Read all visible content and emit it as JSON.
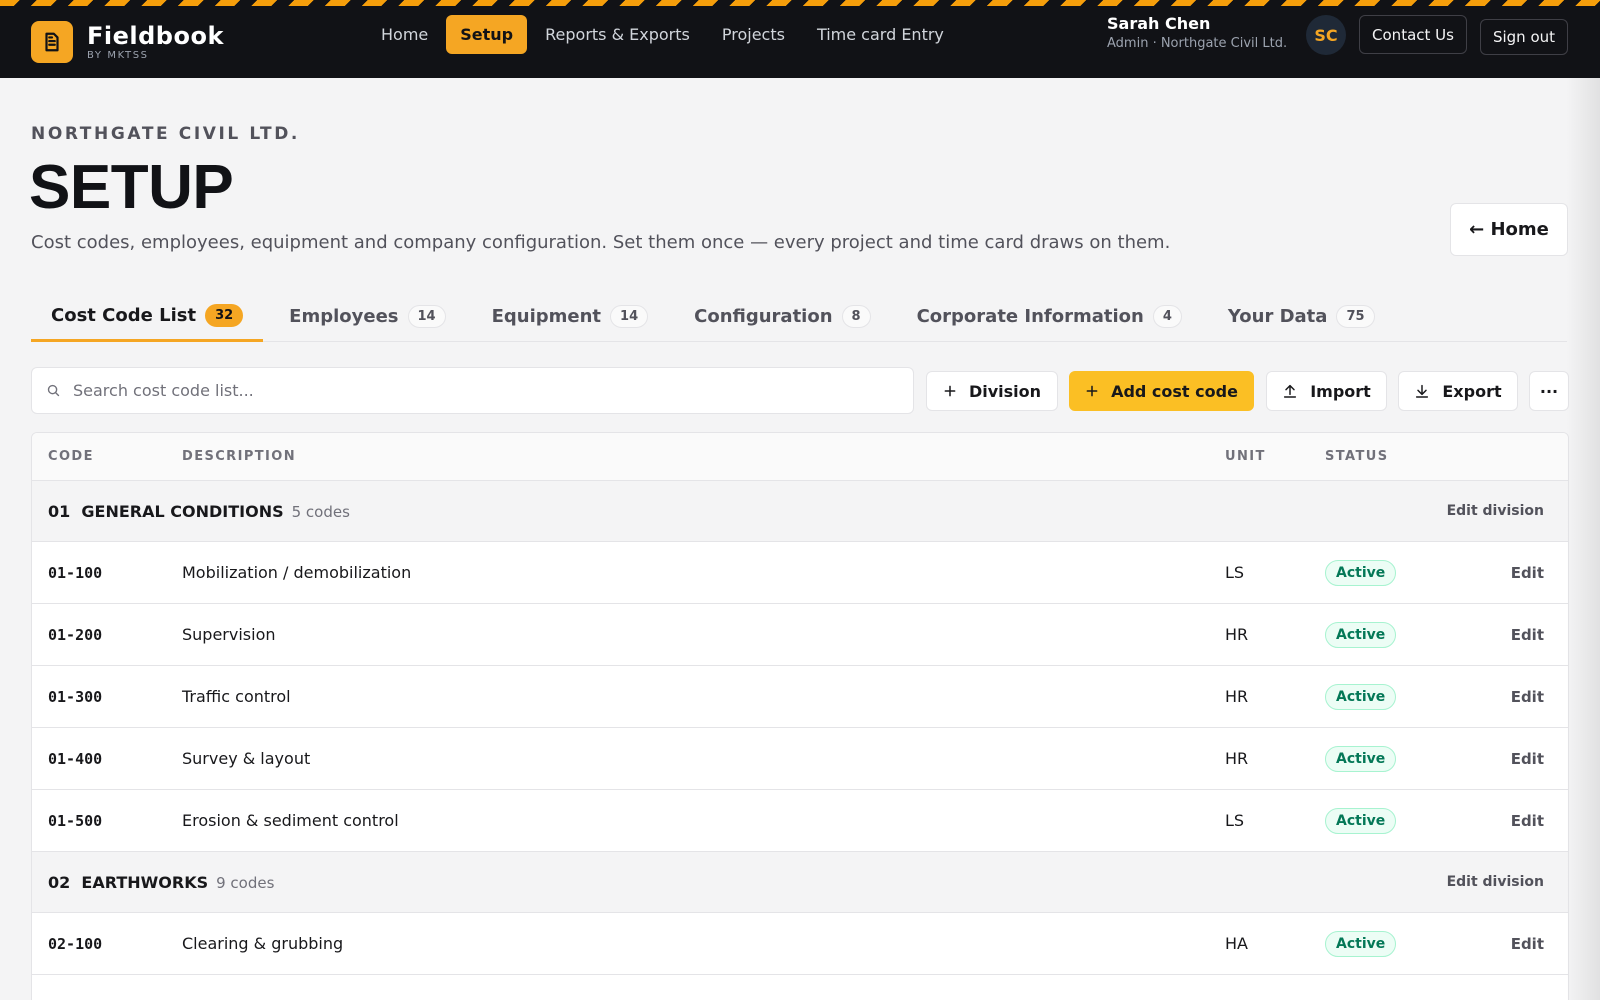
{
  "brand": {
    "name": "Fieldbook",
    "sub": "BY MKTSS"
  },
  "nav": [
    {
      "label": "Home"
    },
    {
      "label": "Setup"
    },
    {
      "label": "Reports & Exports"
    },
    {
      "label": "Projects"
    },
    {
      "label": "Time card Entry"
    }
  ],
  "user": {
    "name": "Sarah Chen",
    "role": "Admin · Northgate Civil Ltd.",
    "initials": "SC"
  },
  "top_buttons": {
    "contact": "Contact Us",
    "signout": "Sign out"
  },
  "header": {
    "company": "NORTHGATE CIVIL LTD.",
    "title": "SETUP",
    "subtitle": "Cost codes, employees, equipment and company configuration. Set them once — every project and time card draws on them.",
    "home_button": "← Home"
  },
  "tabs": [
    {
      "label": "Cost Code List",
      "count": "32"
    },
    {
      "label": "Employees",
      "count": "14"
    },
    {
      "label": "Equipment",
      "count": "14"
    },
    {
      "label": "Configuration",
      "count": "8"
    },
    {
      "label": "Corporate Information",
      "count": "4"
    },
    {
      "label": "Your Data",
      "count": "75"
    }
  ],
  "toolbar": {
    "search_placeholder": "Search cost code list...",
    "division": "Division",
    "add": "Add cost code",
    "import": "Import",
    "export": "Export",
    "more": "···"
  },
  "table": {
    "headers": {
      "code": "CODE",
      "description": "DESCRIPTION",
      "unit": "UNIT",
      "status": "STATUS"
    },
    "edit_division_label": "Edit division",
    "edit_label": "Edit",
    "divisions": [
      {
        "name": "01  GENERAL CONDITIONS",
        "count": "5 codes",
        "rows": [
          {
            "code": "01-100",
            "description": "Mobilization / demobilization",
            "unit": "LS",
            "status": "Active"
          },
          {
            "code": "01-200",
            "description": "Supervision",
            "unit": "HR",
            "status": "Active"
          },
          {
            "code": "01-300",
            "description": "Traffic control",
            "unit": "HR",
            "status": "Active"
          },
          {
            "code": "01-400",
            "description": "Survey & layout",
            "unit": "HR",
            "status": "Active"
          },
          {
            "code": "01-500",
            "description": "Erosion & sediment control",
            "unit": "LS",
            "status": "Active"
          }
        ]
      },
      {
        "name": "02  EARTHWORKS",
        "count": "9 codes",
        "rows": [
          {
            "code": "02-100",
            "description": "Clearing & grubbing",
            "unit": "HA",
            "status": "Active"
          }
        ]
      }
    ]
  },
  "colors": {
    "accent": "#f5a623",
    "topbar": "#111216",
    "active_status": "#047857"
  }
}
